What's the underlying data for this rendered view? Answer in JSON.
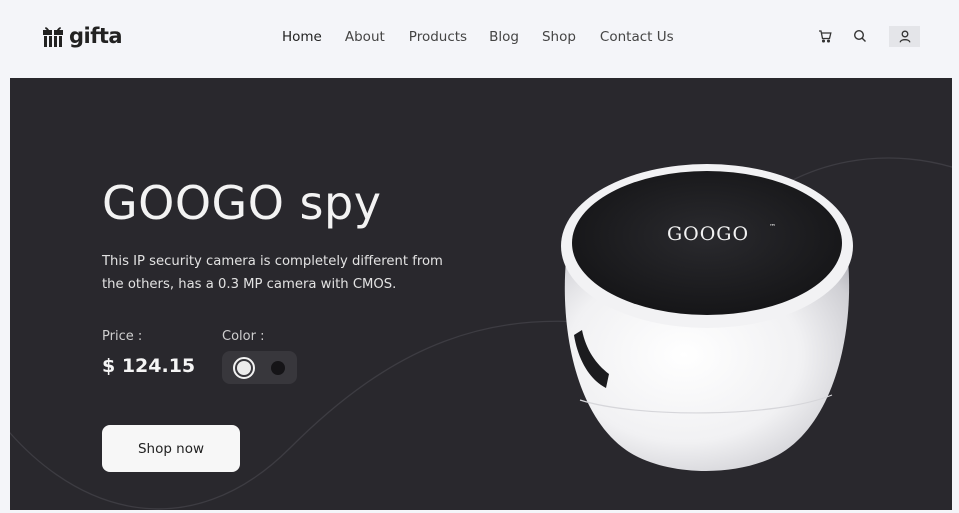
{
  "brand": {
    "name": "gifta"
  },
  "nav": {
    "items": [
      {
        "label": "Home",
        "active": true
      },
      {
        "label": "About",
        "active": false
      },
      {
        "label": "Products",
        "active": false
      },
      {
        "label": "Blog",
        "active": false
      },
      {
        "label": "Shop",
        "active": false
      },
      {
        "label": "Contact Us",
        "active": false
      }
    ]
  },
  "header_icons": [
    "cart-icon",
    "search-icon",
    "user-icon"
  ],
  "hero": {
    "title": "GOOGO spy",
    "description": "This IP security camera is completely different from the others, has a 0.3 MP camera with CMOS.",
    "price_label": "Price :",
    "price_value": "$ 124.15",
    "color_label": "Color :",
    "colors": [
      {
        "name": "white",
        "hex": "#ececec",
        "selected": true
      },
      {
        "name": "black",
        "hex": "#151417",
        "selected": false
      }
    ],
    "cta_label": "Shop now",
    "product_brand": "GOOGO",
    "product_mark": "™"
  },
  "theme": {
    "hero_bg": "#29282d",
    "page_bg": "#f4f5f9",
    "accent": "#f7f7f7"
  }
}
